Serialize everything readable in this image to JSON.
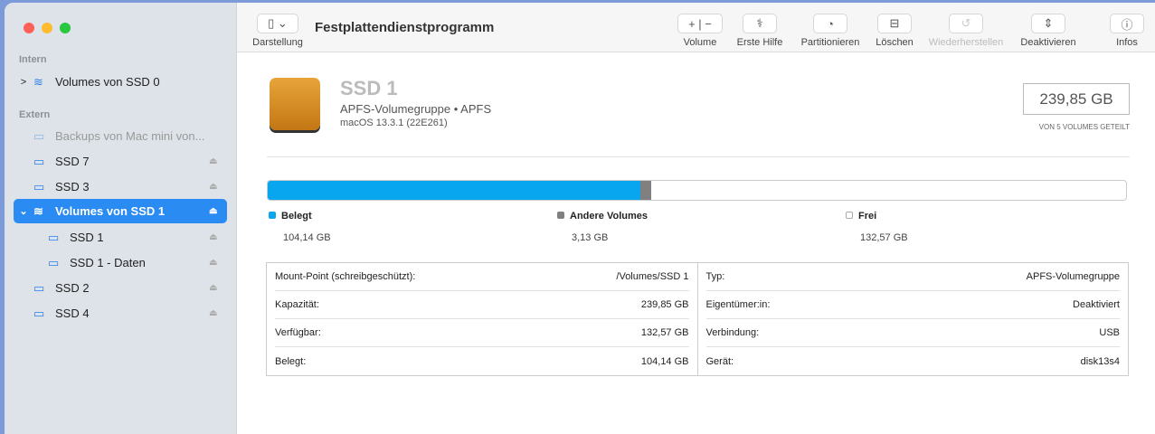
{
  "window": {
    "title": "Festplattendienstprogramm"
  },
  "toolbar": {
    "view": "Darstellung",
    "volume": "Volume",
    "firstaid": "Erste Hilfe",
    "partition": "Partitionieren",
    "erase": "Löschen",
    "restore": "Wiederherstellen",
    "unmount": "Deaktivieren",
    "info": "Infos"
  },
  "sidebar": {
    "intern": "Intern",
    "extern": "Extern",
    "items": [
      {
        "label": "Volumes von SSD 0"
      },
      {
        "label": "Backups von Mac mini von..."
      },
      {
        "label": "SSD 7"
      },
      {
        "label": "SSD 3"
      },
      {
        "label": "Volumes von SSD 1"
      },
      {
        "label": "SSD 1"
      },
      {
        "label": "SSD 1 - Daten"
      },
      {
        "label": "SSD 2"
      },
      {
        "label": "SSD 4"
      }
    ]
  },
  "disk": {
    "name": "SSD 1",
    "type": "APFS-Volumegruppe • APFS",
    "os": "macOS 13.3.1 (22E261)",
    "capacity": "239,85 GB",
    "shared": "VON 5 VOLUMES GETEILT"
  },
  "usage": {
    "used_pct": 43.4,
    "other_pct": 1.3,
    "legend": [
      {
        "label": "Belegt",
        "value": "104,14 GB",
        "color": "#09a6f0"
      },
      {
        "label": "Andere Volumes",
        "value": "3,13 GB",
        "color": "#808080"
      },
      {
        "label": "Frei",
        "value": "132,57 GB",
        "color": "#ffffff"
      }
    ]
  },
  "info": {
    "left": [
      {
        "k": "Mount-Point (schreibgeschützt):",
        "v": "/Volumes/SSD 1"
      },
      {
        "k": "Kapazität:",
        "v": "239,85 GB"
      },
      {
        "k": "Verfügbar:",
        "v": "132,57 GB"
      },
      {
        "k": "Belegt:",
        "v": "104,14 GB"
      }
    ],
    "right": [
      {
        "k": "Typ:",
        "v": "APFS-Volumegruppe"
      },
      {
        "k": "Eigentümer:in:",
        "v": "Deaktiviert"
      },
      {
        "k": "Verbindung:",
        "v": "USB"
      },
      {
        "k": "Gerät:",
        "v": "disk13s4"
      }
    ]
  }
}
